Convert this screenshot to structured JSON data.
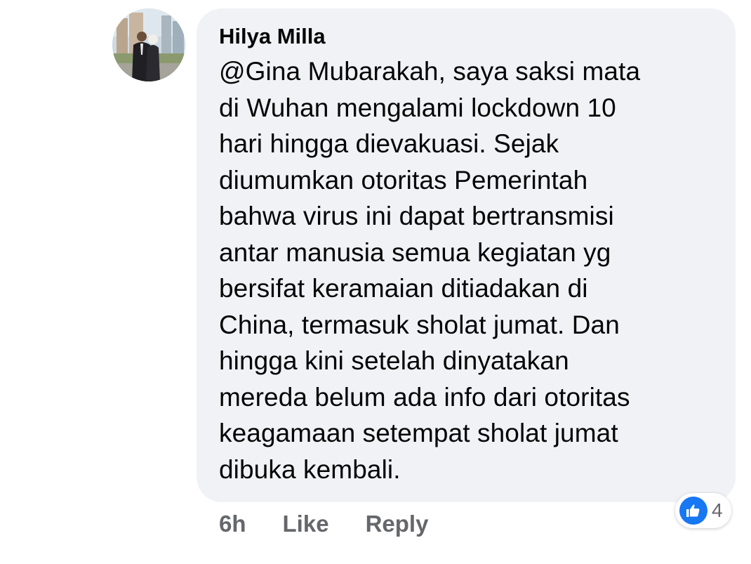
{
  "comment": {
    "author": "Hilya Milla",
    "text": "@Gina Mubarakah, saya saksi mata\ndi Wuhan mengalami lockdown 10\nhari hingga dievakuasi. Sejak\ndiumumkan otoritas Pemerintah\nbahwa virus ini dapat bertransmisi\nantar manusia semua kegiatan yg\nbersifat keramaian ditiadakan di\nChina, termasuk sholat jumat. Dan\nhingga kini setelah dinyatakan\nmereda belum ada info dari otoritas\nkeagamaan setempat sholat jumat\ndibuka kembali.",
    "timestamp": "6h",
    "like_label": "Like",
    "reply_label": "Reply",
    "reaction_icon": "like-thumbs-up-icon",
    "reaction_count": "4"
  },
  "colors": {
    "bubble_bg": "#f0f2f5",
    "text": "#050505",
    "meta_text": "#65676b",
    "like_blue": "#1877f2"
  }
}
